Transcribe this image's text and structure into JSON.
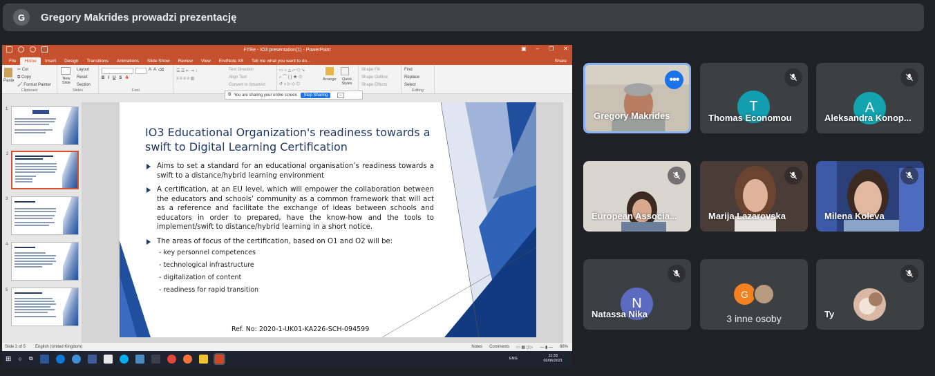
{
  "meet": {
    "presenter_initial": "G",
    "presenting_text": "Gregory Makrides prowadzi prezentację"
  },
  "ppt": {
    "window_title": "FTRe - IO3 presentation(1) - PowerPoint",
    "tabs": [
      "File",
      "Home",
      "Insert",
      "Design",
      "Transitions",
      "Animations",
      "Slide Show",
      "Review",
      "View",
      "EndNote X8"
    ],
    "tell_me": "Tell me what you want to do...",
    "share_label": "Share",
    "ribbon": {
      "paste": "Paste",
      "cut": "Cut",
      "copy": "Copy",
      "format_painter": "Format Painter",
      "clipboard": "Clipboard",
      "new_slide": "New Slide",
      "layout": "Layout",
      "reset": "Reset",
      "section": "Section",
      "slides": "Slides",
      "font": "Font",
      "text_direction": "Text Direction",
      "align_text": "Align Text",
      "convert_smartart": "Convert to SmartArt",
      "arrange": "Arrange",
      "quick_styles": "Quick Styles",
      "shape_fill": "Shape Fill",
      "shape_outline": "Shape Outline",
      "shape_effects": "Shape Effects",
      "find": "Find",
      "replace": "Replace",
      "select": "Select",
      "editing": "Editing"
    },
    "sharing_notice": "You are sharing your entire screen.",
    "stop_sharing": "Stop Sharing",
    "thumb_numbers": [
      "1",
      "2",
      "3",
      "4",
      "5"
    ],
    "slide": {
      "title": "IO3 Educational Organization's readiness towards a swift to Digital Learning Certification",
      "bullets": [
        "Aims to set a standard for an educational organisation’s readiness towards a swift to a distance/hybrid learning environment",
        "A certification, at an EU level, which will empower the collaboration between the educators and schools’ community as a common framework that will act as a reference and facilitate the exchange of ideas between schools and educators in order to prepared, have the know-how and the tools to implement/swift to distance/hybrid learning in a short notice.",
        "The areas of focus of the certification, based on O1 and O2 will be:"
      ],
      "subitems": [
        "- key personnel competences",
        "- technological infrastructure",
        "- digitalization of content",
        "- readiness for rapid transition"
      ],
      "ref": "Ref. No: 2020-1-UK01-KA226-SCH-094599"
    },
    "status": {
      "slide_of": "Slide 2 of 5",
      "language": "English (United Kingdom)",
      "notes": "Notes",
      "comments": "Comments",
      "zoom": "88%"
    },
    "taskbar": {
      "lang": "ENG",
      "time": "11:33",
      "date": "02/06/2021"
    }
  },
  "participants": [
    {
      "name": "Gregory Makrides",
      "type": "video",
      "active": true
    },
    {
      "name": "Thomas Economou",
      "initial": "T",
      "color": "#129eaf",
      "muted": true
    },
    {
      "name": "Aleksandra Konop...",
      "initial": "A",
      "color": "#12a4af",
      "muted": true
    },
    {
      "name": "European Associa...",
      "type": "video",
      "muted": true
    },
    {
      "name": "Marija Lazarovska",
      "type": "video",
      "muted": true
    },
    {
      "name": "Milena Koleva",
      "type": "video",
      "muted": true
    },
    {
      "name": "Natassa Nika",
      "initial": "N",
      "color": "#5c6bc0",
      "muted": true
    },
    {
      "name": "3 inne osoby",
      "initial": "G",
      "color": "#f4811f"
    },
    {
      "name": "Ty",
      "muted": true
    }
  ],
  "colors": {
    "ppt_accent": "#c6512e",
    "meet_bg": "#202124",
    "tile_bg": "#3c4043",
    "active_border": "#8ab4f8",
    "more_button": "#1a73e8",
    "slide_title": "#1f3864"
  }
}
